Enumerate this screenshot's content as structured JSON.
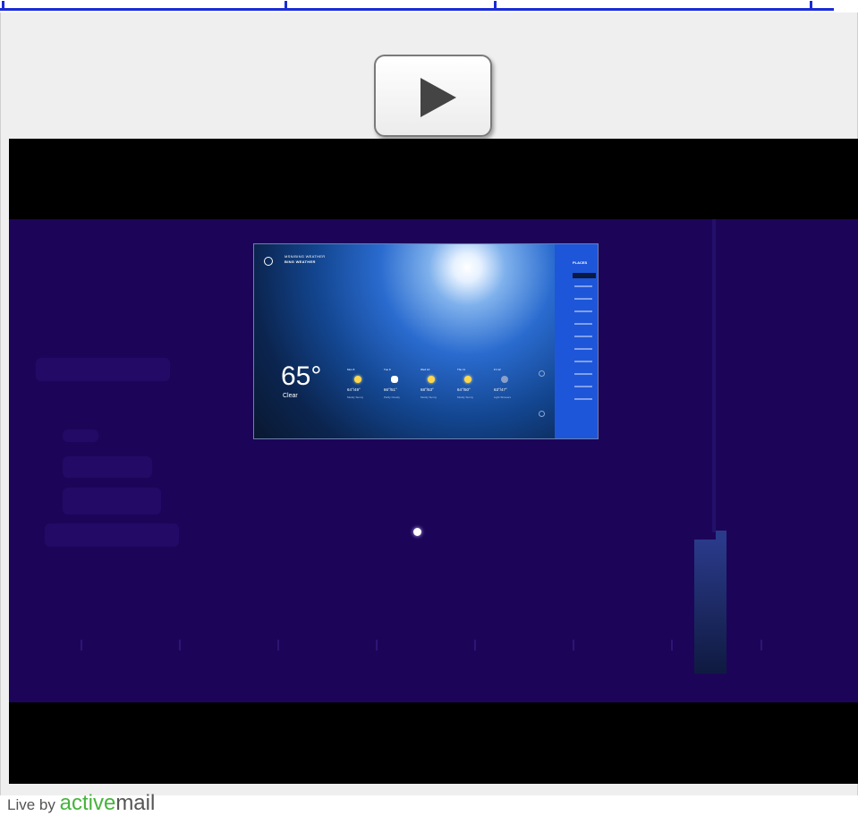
{
  "player": {
    "play_label": "Play"
  },
  "weather_app": {
    "brand_line1": "MSN/BING WEATHER",
    "brand_line2": "BING WEATHER",
    "temperature": "65°",
    "condition": "Clear",
    "forecast": [
      {
        "day": "Mon 8",
        "range": "64°/49°",
        "desc": "Mostly Sunny"
      },
      {
        "day": "Tue 9",
        "range": "66°/51°",
        "desc": "Partly Cloudy"
      },
      {
        "day": "Wed 10",
        "range": "68°/53°",
        "desc": "Mostly Sunny"
      },
      {
        "day": "Thu 11",
        "range": "64°/50°",
        "desc": "Mostly Sunny"
      },
      {
        "day": "Fri 12",
        "range": "63°/47°",
        "desc": "Light Showers"
      }
    ],
    "charms_title": "PLACES"
  },
  "attribution": {
    "prefix": "Live by",
    "brand_active": "active",
    "brand_mail": "mail"
  },
  "colors": {
    "link": "#1a2bd6",
    "stage": "#1c0558",
    "charms": "#1e56d9",
    "brand_green": "#46b33c"
  }
}
